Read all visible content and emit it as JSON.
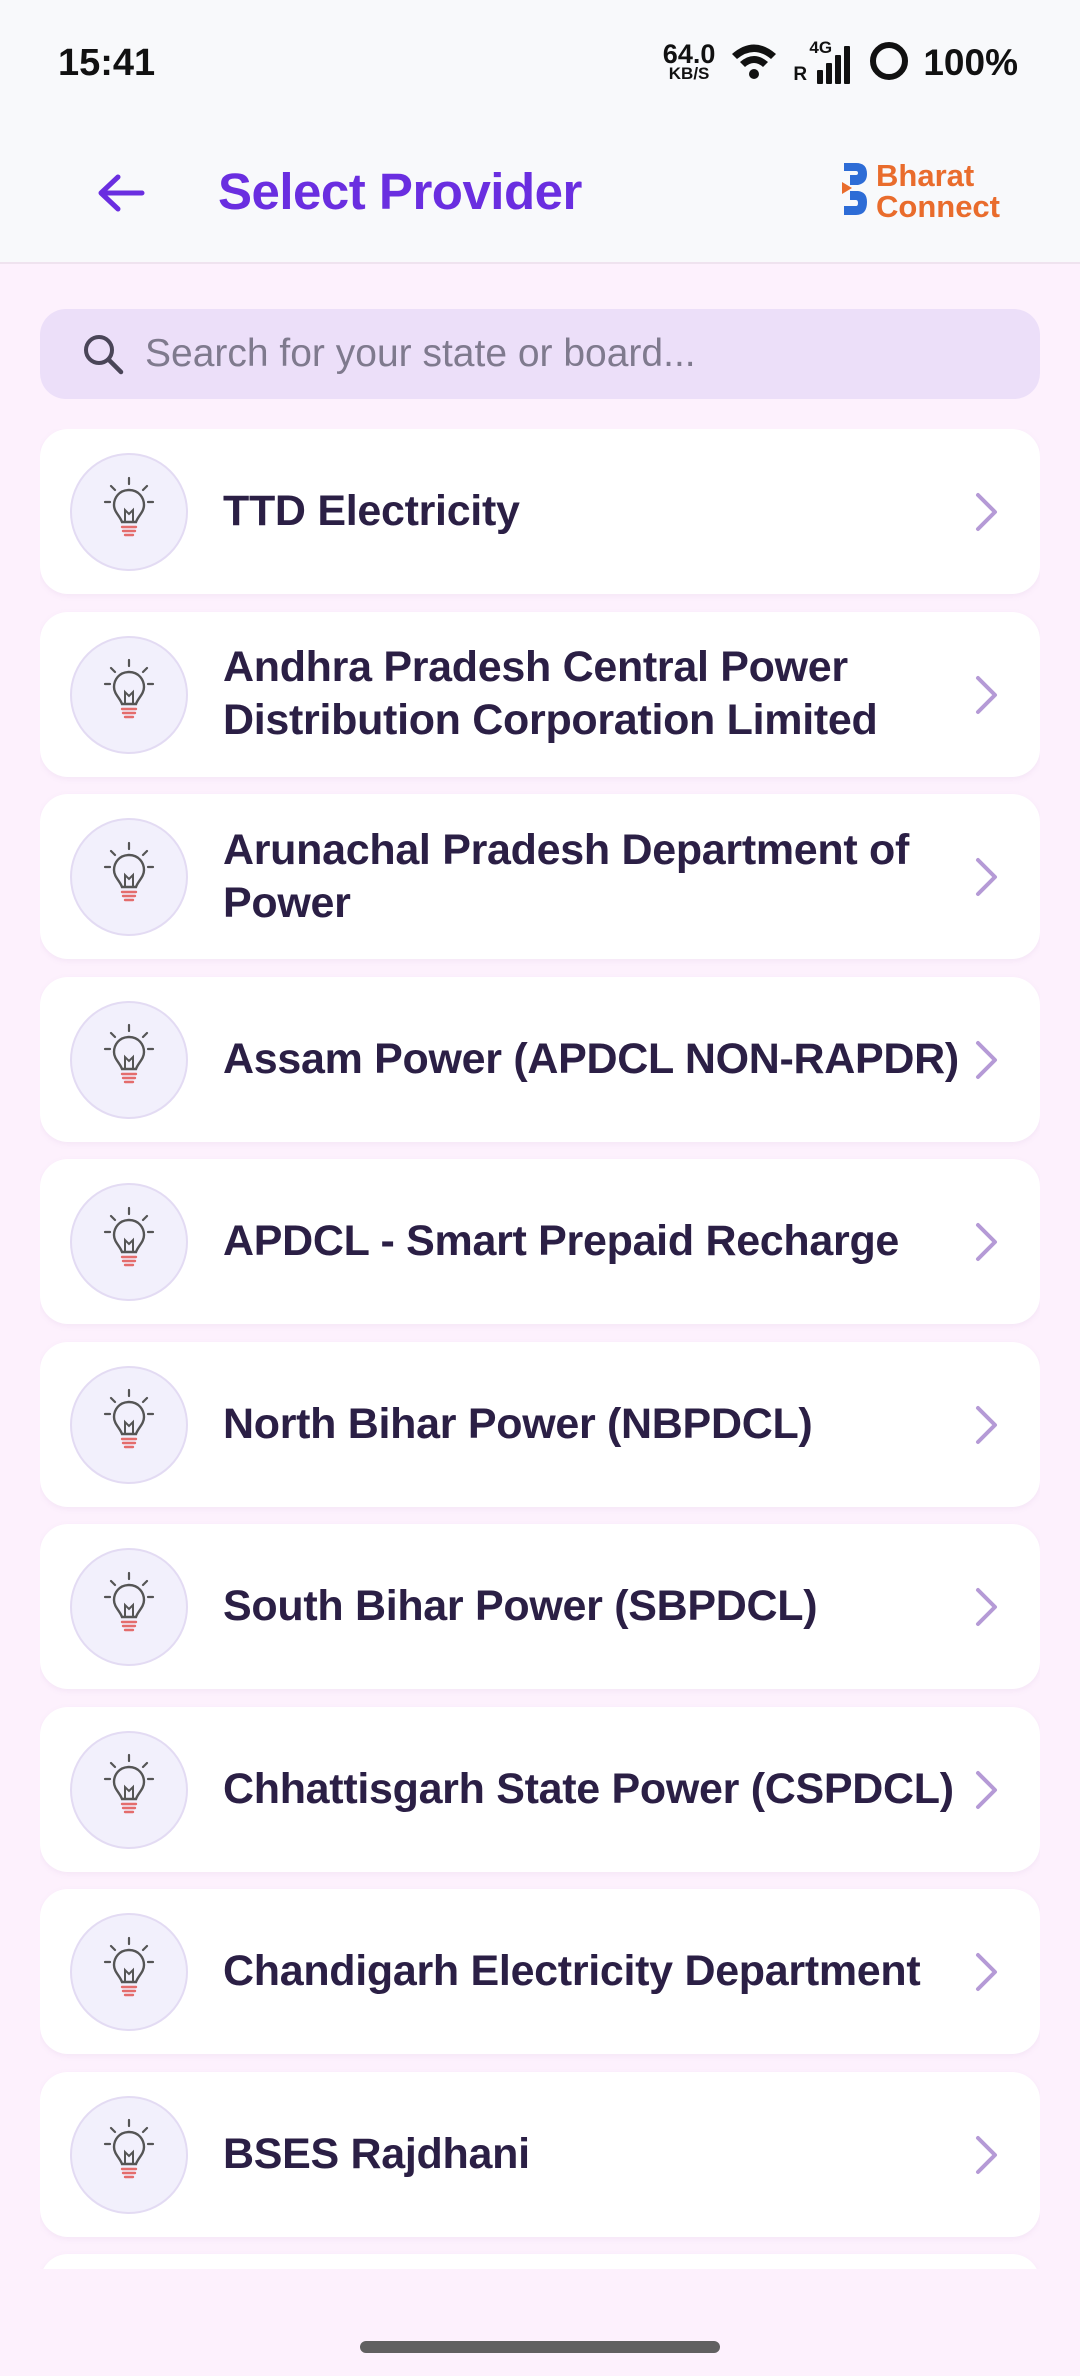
{
  "status_bar": {
    "time": "15:41",
    "net_speed_value": "64.0",
    "net_speed_unit": "KB/S",
    "network_type": "4G",
    "roaming": "R",
    "battery": "100%"
  },
  "header": {
    "title": "Select Provider",
    "brand_line1": "Bharat",
    "brand_line2": "Connect"
  },
  "search": {
    "placeholder": "Search for your state or board..."
  },
  "providers": [
    {
      "name": "TTD Electricity"
    },
    {
      "name": "Andhra Pradesh Central Power Distribution Corporation Limited"
    },
    {
      "name": "Arunachal Pradesh Department of Power"
    },
    {
      "name": "Assam Power (APDCL NON-RAPDR)"
    },
    {
      "name": "APDCL - Smart Prepaid Recharge"
    },
    {
      "name": "North Bihar Power (NBPDCL)"
    },
    {
      "name": "South Bihar Power (SBPDCL)"
    },
    {
      "name": "Chhattisgarh State Power (CSPDCL)"
    },
    {
      "name": "Chandigarh Electricity Department"
    },
    {
      "name": "BSES Rajdhani"
    }
  ],
  "colors": {
    "accent": "#6a2ee0",
    "brand_orange": "#e96c2c",
    "brand_blue": "#2d6cd6",
    "background": "#fdf1fd",
    "search_bg": "#ecdff9",
    "chevron": "#b59ad6"
  },
  "icons": {
    "back": "arrow-left-icon",
    "search": "search-icon",
    "provider": "lightbulb-icon",
    "chevron": "chevron-right-icon"
  }
}
